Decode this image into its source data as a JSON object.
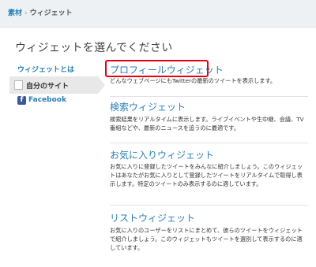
{
  "breadcrumb": {
    "root": "素材",
    "separator": "›",
    "current": "ウィジェット"
  },
  "page_title": "ウィジェットを選んでください",
  "sidebar": {
    "heading": "ウィジェットとは",
    "items": [
      {
        "label": "自分のサイト",
        "active": true,
        "icon": "page-icon"
      },
      {
        "label": "Facebook",
        "active": false,
        "icon": "facebook-icon"
      }
    ]
  },
  "widgets": [
    {
      "title": "プロフィールウィジェット",
      "description": "どんなウェブページにもTwitterの最新のツイートを表示します。",
      "highlighted": true
    },
    {
      "title": "検索ウィジェット",
      "description": "検索結果をリアルタイムに表示します。ライブイベントや生中継、会議、TV番組などや、最新のニュースを追うのに最適です。"
    },
    {
      "title": "お気に入りウィジェット",
      "description": "お気に入りに登録したツイートをみんなに紹介しましょう。このウィジェットはあなたがお気に入りとして登録したツイートをリアルタイムで取得し表示します。特定のツイートのみ表示するのに適しています。"
    },
    {
      "title": "リストウィジェット",
      "description": "お気に入りのユーザーをリストにまとめて、彼らのツイートをウィジェットで紹介しましょう。このウィジェットもツイートを選別して表示するのに適しています。"
    }
  ],
  "colors": {
    "link": "#2a7fb4",
    "highlight": "#e60012",
    "facebook": "#3b5998"
  }
}
